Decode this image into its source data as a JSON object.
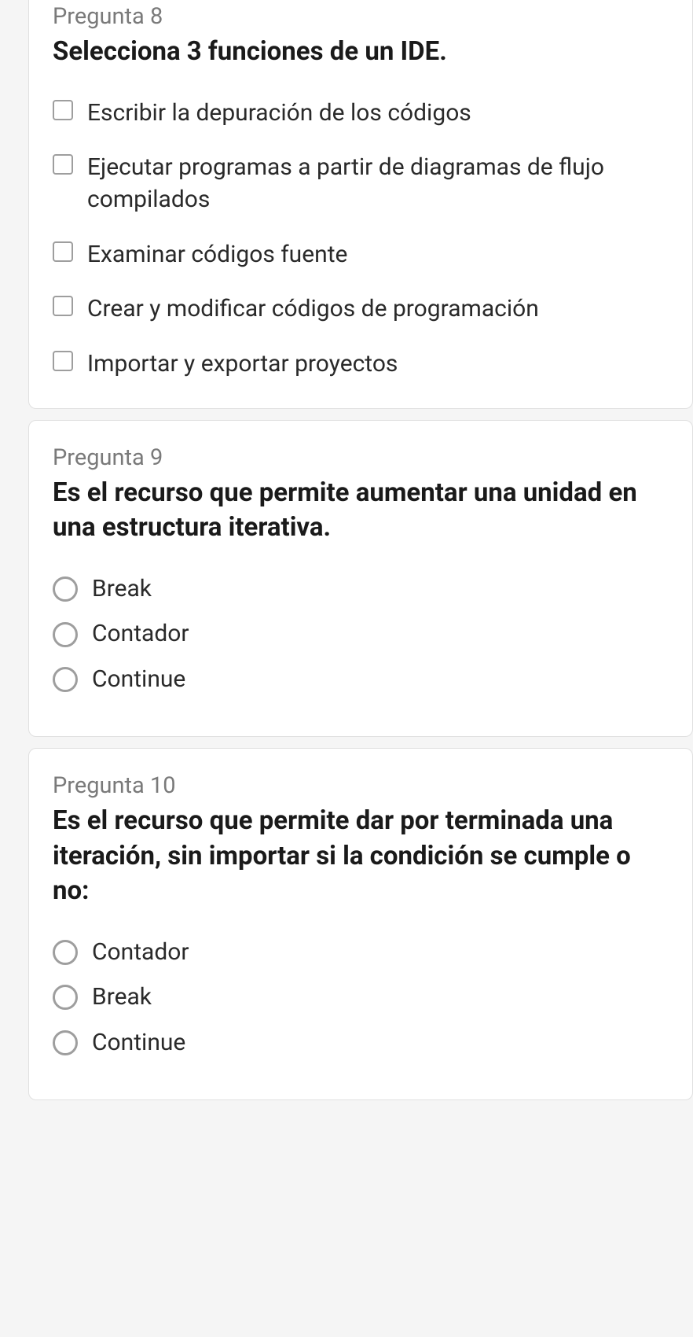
{
  "questions": [
    {
      "number": "Pregunta 8",
      "text": "Selecciona 3 funciones de un IDE.",
      "type": "checkbox",
      "options": [
        "Escribir la depuración de los códigos",
        "Ejecutar programas a partir de diagramas de flujo compilados",
        "Examinar códigos fuente",
        "Crear y modificar códigos de programación",
        "Importar y exportar proyectos"
      ]
    },
    {
      "number": "Pregunta 9",
      "text": "Es el recurso que permite aumentar una unidad en una estructura iterativa.",
      "type": "radio",
      "options": [
        "Break",
        "Contador",
        "Continue"
      ]
    },
    {
      "number": "Pregunta 10",
      "text": "Es el recurso que permite dar por terminada una iteración, sin importar si la condición se cumple o no:",
      "type": "radio",
      "options": [
        "Contador",
        "Break",
        "Continue"
      ]
    }
  ]
}
